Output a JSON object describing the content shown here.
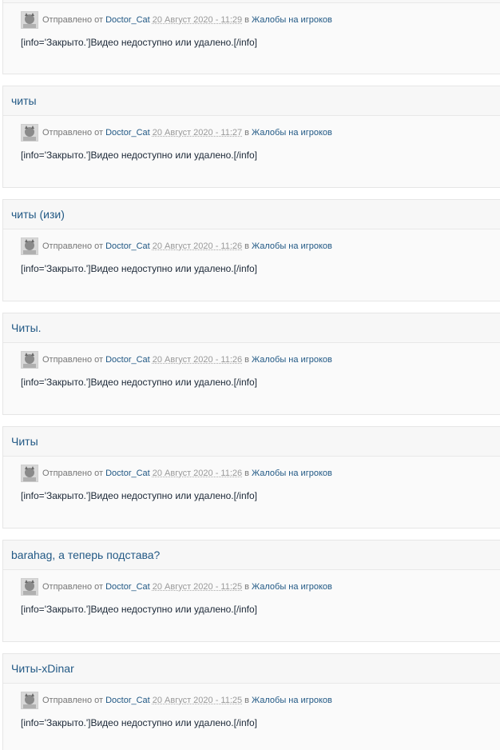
{
  "meta_labels": {
    "posted_by": "Отправлено от",
    "in": "в"
  },
  "posts": [
    {
      "title": "",
      "author": "Doctor_Cat",
      "date": "20 Август 2020 - 11:29",
      "forum": "Жалобы на игроков",
      "content": "[info='Закрыто.']Видео недоступно или удалено.[/info]"
    },
    {
      "title": "читы",
      "author": "Doctor_Cat",
      "date": "20 Август 2020 - 11:27",
      "forum": "Жалобы на игроков",
      "content": "[info='Закрыто.']Видео недоступно или удалено.[/info]"
    },
    {
      "title": "читы (изи)",
      "author": "Doctor_Cat",
      "date": "20 Август 2020 - 11:26",
      "forum": "Жалобы на игроков",
      "content": "[info='Закрыто.']Видео недоступно или удалено.[/info]"
    },
    {
      "title": "Читы.",
      "author": "Doctor_Cat",
      "date": "20 Август 2020 - 11:26",
      "forum": "Жалобы на игроков",
      "content": "[info='Закрыто.']Видео недоступно или удалено.[/info]"
    },
    {
      "title": "Читы",
      "author": "Doctor_Cat",
      "date": "20 Август 2020 - 11:26",
      "forum": "Жалобы на игроков",
      "content": "[info='Закрыто.']Видео недоступно или удалено.[/info]"
    },
    {
      "title": "barahag, а теперь подстава?",
      "author": "Doctor_Cat",
      "date": "20 Август 2020 - 11:25",
      "forum": "Жалобы на игроков",
      "content": "[info='Закрыто.']Видео недоступно или удалено.[/info]"
    },
    {
      "title": "Читы-xDinar",
      "author": "Doctor_Cat",
      "date": "20 Август 2020 - 11:25",
      "forum": "Жалобы на игроков",
      "content": "[info='Закрыто.']Видео недоступно или удалено.[/info]"
    }
  ]
}
